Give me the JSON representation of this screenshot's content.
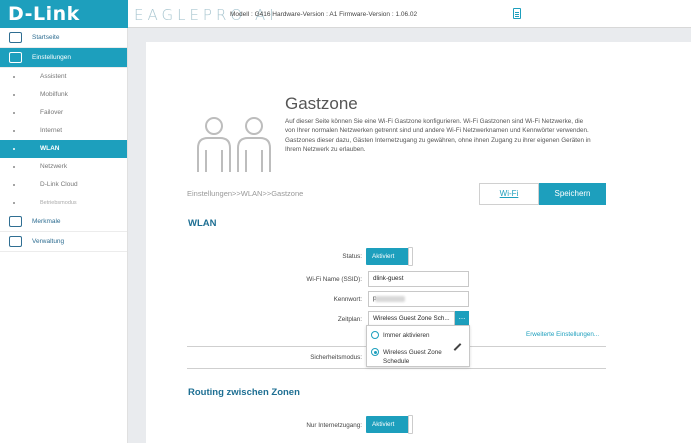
{
  "header": {
    "logo": "D-Link",
    "product": "EAGLEPRO AI",
    "model_info": "Modell : G416 Hardware-Version : A1 Firmware-Version : 1.06.02"
  },
  "sidebar": {
    "items": [
      {
        "label": "Startseite",
        "icon": "home-network-icon"
      },
      {
        "label": "Einstellungen",
        "icon": "settings-icon",
        "active": true
      },
      {
        "label": "Merkmale",
        "icon": "features-icon"
      },
      {
        "label": "Verwaltung",
        "icon": "management-icon"
      }
    ],
    "sub_items": [
      "Assistent",
      "Mobilfunk",
      "Failover",
      "Internet",
      "WLAN",
      "Netzwerk",
      "D-Link Cloud",
      "Betriebsmodus"
    ],
    "active_sub": "WLAN"
  },
  "page": {
    "title": "Gastzone",
    "description": "Auf dieser Seite können Sie eine Wi-Fi Gastzone konfigurieren. Wi-Fi Gastzonen sind Wi-Fi Netzwerke, die von Ihrer normalen Netzwerken getrennt sind und andere Wi-Fi Netzwerknamen und Kennwörter verwenden. Gastzones dieser dazu, Gästen Internetzugang zu gewähren, ohne ihnen Zugang zu ihrer eigenen Geräten in Ihrem Netzwerk zu erlauben.",
    "breadcrumb": "Einstellungen>>WLAN>>Gastzone",
    "wifi_button": "Wi-Fi",
    "save_button": "Speichern"
  },
  "wlan": {
    "section_title": "WLAN",
    "status_label": "Status:",
    "status_value": "Aktiviert",
    "ssid_label": "Wi-Fi Name (SSID):",
    "ssid_value": "dlink-guest",
    "password_label": "Kennwort:",
    "password_value": "p",
    "schedule_label": "Zeitplan:",
    "schedule_value": "Wireless Guest Zone Sch...",
    "schedule_button": "...",
    "advanced_link": "Erweiterte Einstellungen...",
    "security_label": "Sicherheitsmodus:",
    "dropdown_options": [
      {
        "label": "Immer aktivieren",
        "selected": false
      },
      {
        "label": "Wireless Guest Zone Schedule",
        "selected": true
      }
    ]
  },
  "routing": {
    "section_title": "Routing zwischen Zonen",
    "internet_only_label": "Nur Internetzugang:",
    "internet_only_value": "Aktiviert"
  },
  "colors": {
    "accent": "#1d9fbd",
    "section_title": "#1e6f93"
  }
}
